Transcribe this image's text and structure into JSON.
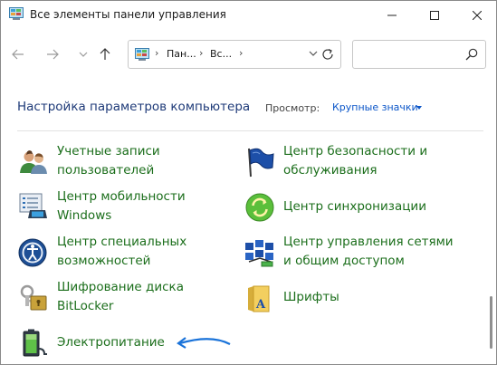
{
  "window": {
    "title": "Все элементы панели управления",
    "icon": "control-panel-icon"
  },
  "nav": {
    "back_icon": "arrow-left-icon",
    "forward_icon": "arrow-right-icon",
    "recent_icon": "chevron-down-icon",
    "up_icon": "arrow-up-icon",
    "breadcrumbs": [
      "Пан...",
      "Вс..."
    ],
    "search_placeholder": ""
  },
  "header": {
    "heading": "Настройка параметров компьютера",
    "view_label": "Просмотр:",
    "view_value": "Крупные значки"
  },
  "items": [
    {
      "label": "Учетные записи пользователей",
      "icon": "user-accounts-icon"
    },
    {
      "label": "Центр безопасности и обслуживания",
      "icon": "security-flag-icon"
    },
    {
      "label": "Центр мобильности Windows",
      "icon": "mobility-center-icon"
    },
    {
      "label": "Центр синхронизации",
      "icon": "sync-center-icon"
    },
    {
      "label": "Центр специальных возможностей",
      "icon": "accessibility-icon"
    },
    {
      "label": "Центр управления сетями и общим доступом",
      "icon": "network-center-icon"
    },
    {
      "label": "Шифрование диска BitLocker",
      "icon": "bitlocker-icon"
    },
    {
      "label": "Шрифты",
      "icon": "fonts-folder-icon"
    },
    {
      "label": "Электропитание",
      "icon": "power-options-icon"
    }
  ],
  "colors": {
    "link_green": "#1b6e1b",
    "heading_blue": "#1e3a78",
    "view_blue": "#0a55c8",
    "annotation_arrow": "#1a73d9"
  }
}
